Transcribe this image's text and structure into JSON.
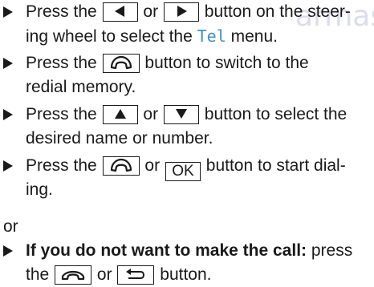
{
  "watermark": "armas",
  "steps": [
    {
      "line1": {
        "a": "Press the",
        "b": "or",
        "c": "button on the steer-"
      },
      "line2": {
        "a": "ing wheel to select the",
        "tel": "Tel",
        "b": "menu."
      },
      "icons": [
        "left-arrow-key-icon",
        "right-arrow-key-icon"
      ]
    },
    {
      "line1": {
        "a": "Press the",
        "b": "button to switch to the"
      },
      "line2": {
        "a": "redial memory."
      },
      "icons": [
        "phone-pickup-key-icon"
      ]
    },
    {
      "line1": {
        "a": "Press the",
        "b": "or",
        "c": "button to select the"
      },
      "line2": {
        "a": "desired name or number."
      },
      "icons": [
        "up-arrow-key-icon",
        "down-arrow-key-icon"
      ]
    },
    {
      "line1": {
        "a": "Press the",
        "b": "or",
        "ok": "OK",
        "c": "button to start dial-"
      },
      "line2": {
        "a": "ing."
      },
      "icons": [
        "phone-pickup-key-icon"
      ]
    }
  ],
  "or_text": "or",
  "final_step": {
    "bold": "If you do not want to make the call:",
    "a": "press",
    "line2": {
      "a": "the",
      "b": "or",
      "c": "button."
    },
    "icons": [
      "phone-hangup-key-icon",
      "back-key-icon"
    ]
  }
}
